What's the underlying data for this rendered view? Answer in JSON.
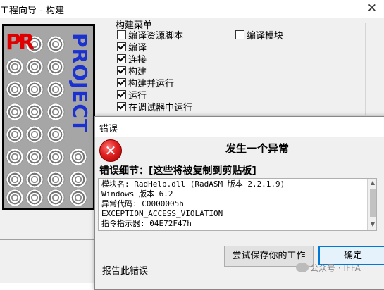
{
  "wizard": {
    "title": "工程向导 - 构建",
    "close_glyph": "✕",
    "logo": {
      "letters": "PR",
      "text": "PROJECT"
    },
    "build_menu": {
      "title": "构建菜单",
      "items": [
        {
          "label": "编译资源脚本",
          "checked": false
        },
        {
          "label": "编译",
          "checked": true
        },
        {
          "label": "连接",
          "checked": true
        },
        {
          "label": "构建",
          "checked": true
        },
        {
          "label": "构建并运行",
          "checked": true
        },
        {
          "label": "运行",
          "checked": true
        },
        {
          "label": "在调试器中运行",
          "checked": true
        }
      ],
      "compile_module": {
        "label": "编译模块",
        "checked": false
      }
    }
  },
  "error_dialog": {
    "title": "错误",
    "icon": "error-x-icon",
    "heading": "发生一个异常",
    "detail_label": "错误细节：[这些将被复制到剪贴板]",
    "details": [
      "模块名: RadHelp.dll (RadASM 版本 2.2.1.9)",
      "Windows 版本 6.2",
      "异常代码: C0000005h",
      "EXCEPTION_ACCESS_VIOLATION",
      "指令指示器: 04E72F47h"
    ],
    "save_button": "尝试保存你的工作",
    "ok_button": "确定",
    "report_link": "报告此错误"
  },
  "watermark": "公众号 · IFFA"
}
